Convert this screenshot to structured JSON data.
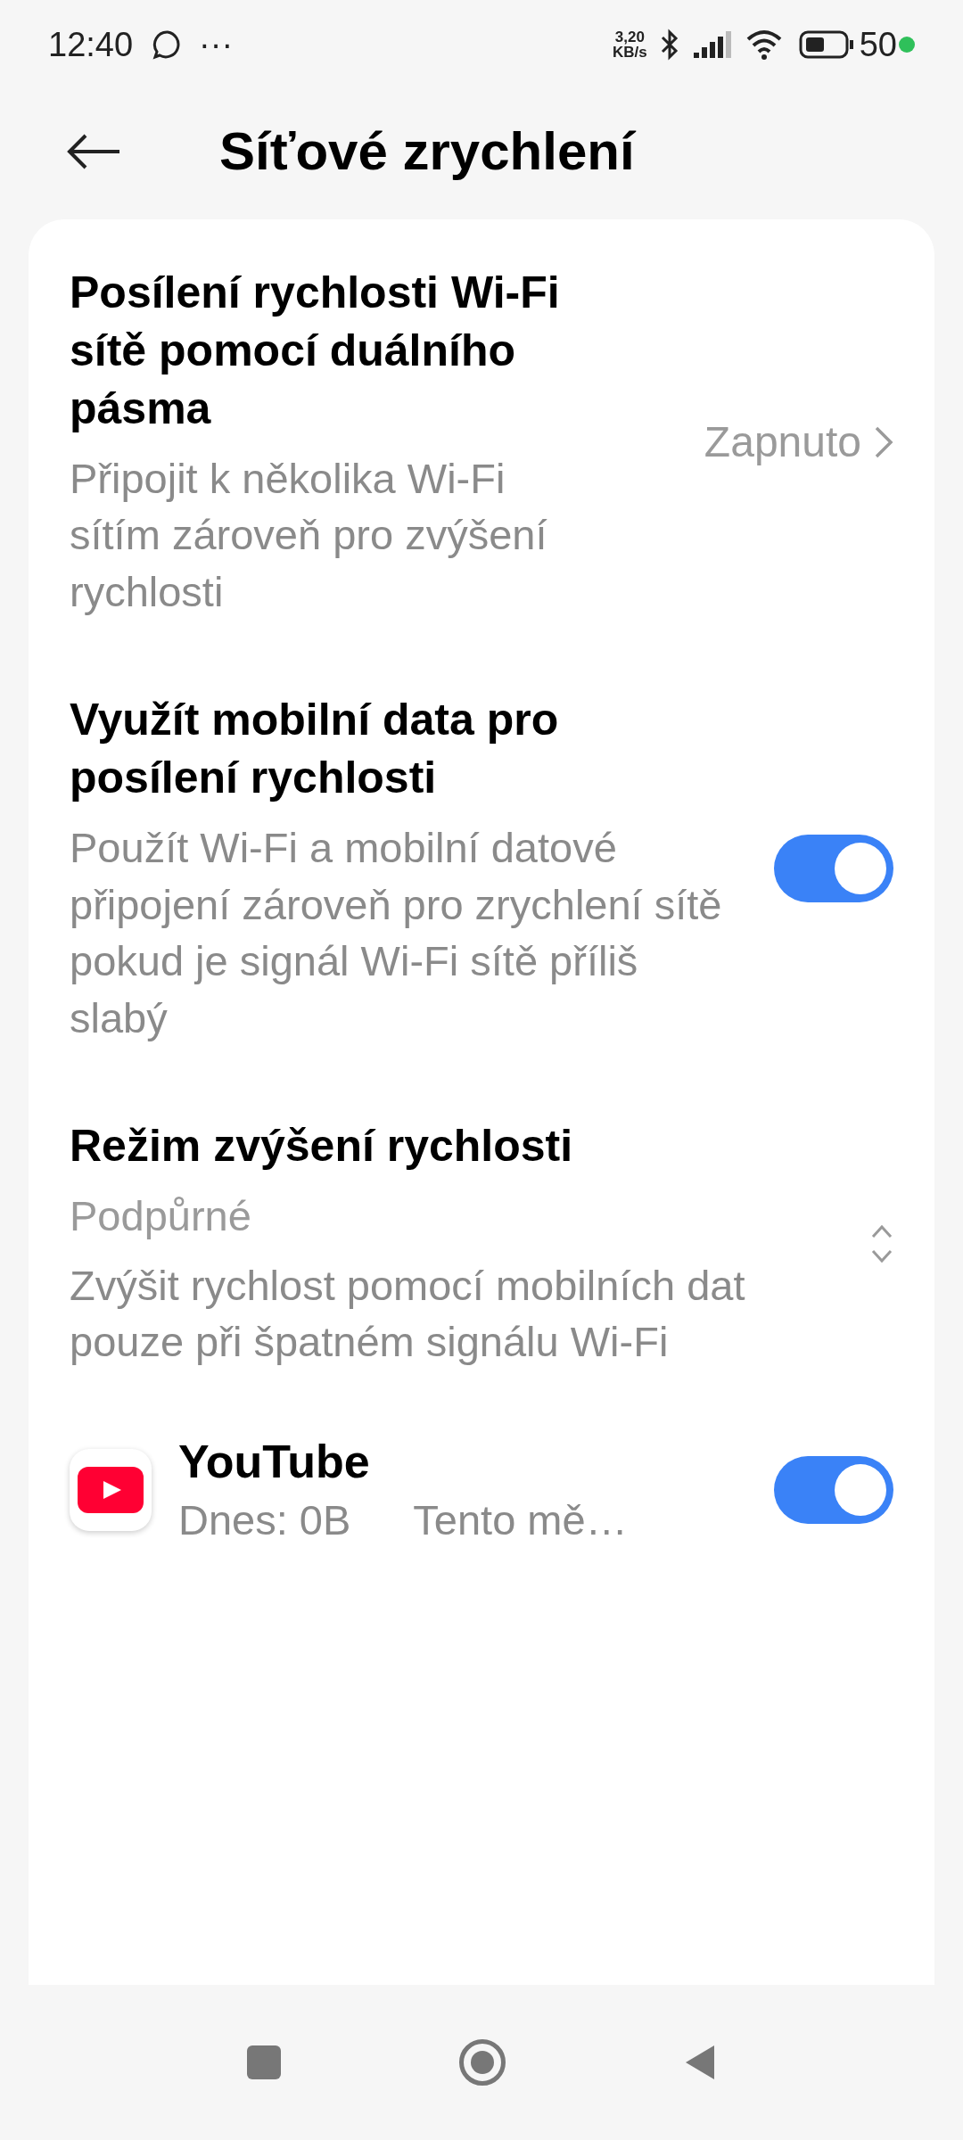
{
  "status_bar": {
    "time": "12:40",
    "more": "···",
    "speed_value": "3,20",
    "speed_unit": "KB/s",
    "battery": "50"
  },
  "header": {
    "title": "Síťové zrychlení"
  },
  "items": [
    {
      "kind": "link",
      "title": "Posílení rychlosti Wi-Fi sítě pomocí duálního pásma",
      "description": "Připojit k několika Wi-Fi sítím zároveň pro zvýšení rychlosti",
      "value": "Zapnuto"
    },
    {
      "kind": "toggle",
      "title": "Využít mobilní data pro posílení rychlosti",
      "description": "Použít Wi-Fi a mobilní datové připojení zároveň pro zrychlení sítě pokud je signál Wi-Fi sítě příliš slabý",
      "on": true
    },
    {
      "kind": "select",
      "title": "Režim zvýšení rychlosti",
      "value": "Podpůrné",
      "description": "Zvýšit rychlost pomocí mobilních dat pouze při špatném signálu Wi-Fi"
    },
    {
      "kind": "app",
      "title": "YouTube",
      "today": "Dnes: 0B",
      "month": "Tento mě…",
      "on": true
    }
  ]
}
